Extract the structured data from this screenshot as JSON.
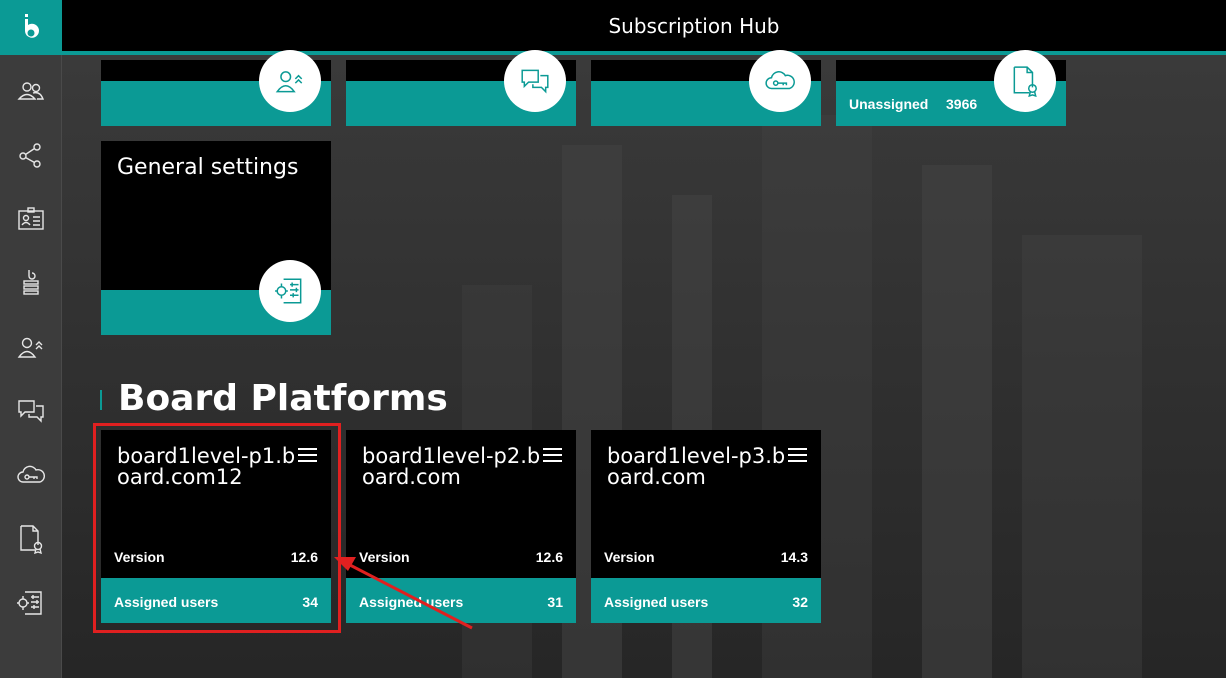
{
  "header": {
    "title": "Subscription Hub"
  },
  "sidebar": {
    "items": [
      {
        "name": "users-icon"
      },
      {
        "name": "share-network-icon"
      },
      {
        "name": "id-card-icon"
      },
      {
        "name": "board-server-icon"
      },
      {
        "name": "user-upgrade-icon"
      },
      {
        "name": "chat-icon"
      },
      {
        "name": "cloud-key-icon"
      },
      {
        "name": "license-certificate-icon"
      },
      {
        "name": "settings-panel-icon"
      }
    ]
  },
  "top_tiles": [
    {
      "icon": "user-upgrade-icon",
      "label": "",
      "count": ""
    },
    {
      "icon": "chat-icon",
      "label": "",
      "count": ""
    },
    {
      "icon": "cloud-key-icon",
      "label": "",
      "count": ""
    },
    {
      "icon": "license-certificate-icon",
      "label": "Unassigned",
      "count": "3966"
    }
  ],
  "general_settings": {
    "title": "General settings",
    "icon": "settings-panel-icon"
  },
  "section": {
    "title": "Board Platforms"
  },
  "platforms": [
    {
      "name": "board1level-p1.board.com12",
      "version_label": "Version",
      "version": "12.6",
      "users_label": "Assigned users",
      "users": "34"
    },
    {
      "name": "board1level-p2.board.com",
      "version_label": "Version",
      "version": "12.6",
      "users_label": "Assigned users",
      "users": "31"
    },
    {
      "name": "board1level-p3.board.com",
      "version_label": "Version",
      "version": "14.3",
      "users_label": "Assigned users",
      "users": "32"
    }
  ],
  "colors": {
    "accent": "#0b9a95",
    "annotation": "#e02020"
  }
}
